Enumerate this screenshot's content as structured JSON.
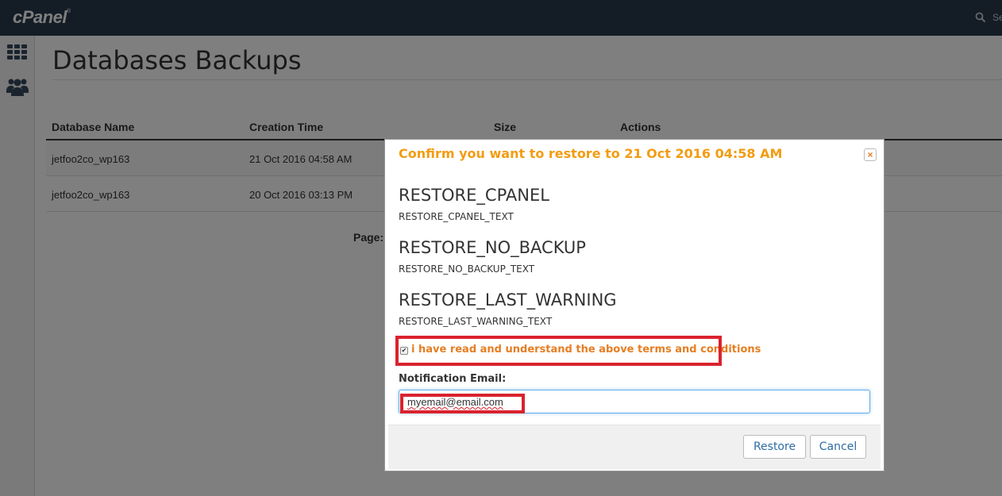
{
  "brand": {
    "logo_text": "cPanel",
    "logo_mark": "®"
  },
  "topbar": {
    "search_text": "Se",
    "search_icon": "search-icon"
  },
  "sidebar": {
    "items": [
      {
        "icon": "grid-icon"
      },
      {
        "icon": "users-icon"
      }
    ]
  },
  "page": {
    "title": "Databases Backups"
  },
  "table": {
    "columns": [
      "Database Name",
      "Creation Time",
      "Size",
      "Actions"
    ],
    "rows": [
      {
        "name": "jetfoo2co_wp163",
        "time": "21 Oct 2016 04:58 AM"
      },
      {
        "name": "jetfoo2co_wp163",
        "time": "20 Oct 2016 03:13 PM"
      }
    ]
  },
  "pager": {
    "label": "Page:"
  },
  "modal": {
    "title": "Confirm you want to restore to 21 Oct 2016 04:58 AM",
    "close_glyph": "×",
    "sections": [
      {
        "heading": "RESTORE_CPANEL",
        "text": "RESTORE_CPANEL_TEXT"
      },
      {
        "heading": "RESTORE_NO_BACKUP",
        "text": "RESTORE_NO_BACKUP_TEXT"
      },
      {
        "heading": "RESTORE_LAST_WARNING",
        "text": "RESTORE_LAST_WARNING_TEXT"
      }
    ],
    "terms_checked": true,
    "terms_check_glyph": "✔",
    "terms_label": "i have read and understand the above terms and conditions",
    "email_label": "Notification Email:",
    "email_value": "myemail@email.com",
    "buttons": {
      "restore": "Restore",
      "cancel": "Cancel"
    }
  },
  "colors": {
    "topbar": "#293a4a",
    "accent_orange": "#f39c12",
    "highlight_red": "#d9232e",
    "link_blue": "#2e6da4"
  }
}
